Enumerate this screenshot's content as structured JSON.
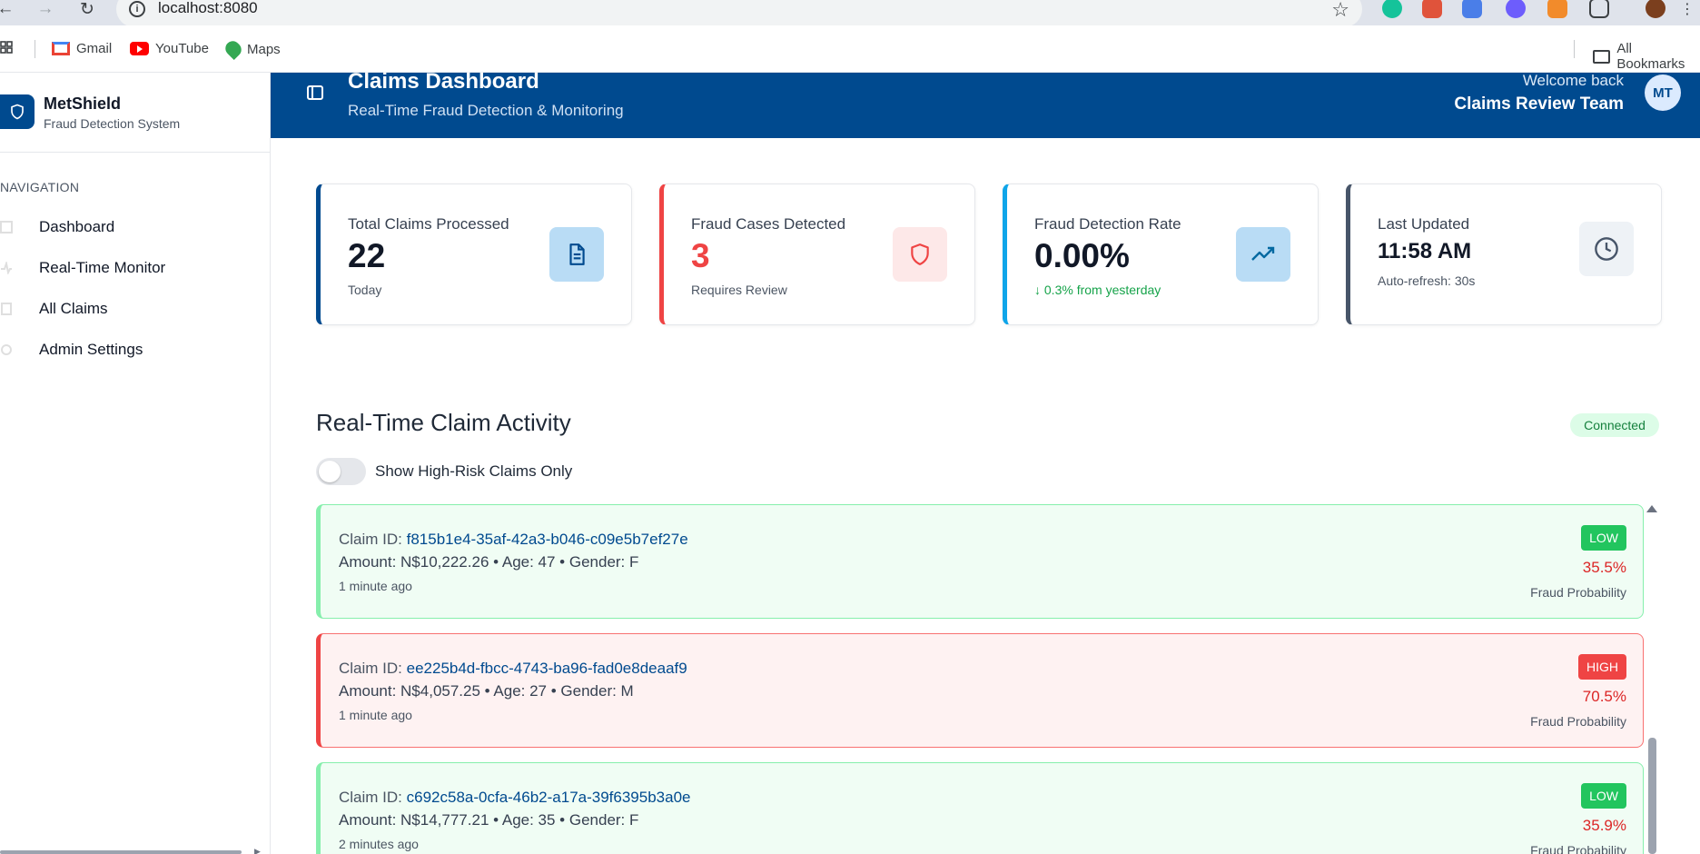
{
  "browser": {
    "url": "localhost:8080",
    "bookmarks": [
      {
        "label": "Gmail",
        "icon": "gmail-icon"
      },
      {
        "label": "YouTube",
        "icon": "youtube-icon"
      },
      {
        "label": "Maps",
        "icon": "maps-icon"
      }
    ],
    "all_bookmarks": "All Bookmarks"
  },
  "sidebar": {
    "app_name": "MetShield",
    "app_subtitle": "Fraud Detection System",
    "nav_heading": "NAVIGATION",
    "items": [
      {
        "label": "Dashboard",
        "icon": "dashboard-icon"
      },
      {
        "label": "Real-Time Monitor",
        "icon": "activity-icon"
      },
      {
        "label": "All Claims",
        "icon": "file-icon"
      },
      {
        "label": "Admin Settings",
        "icon": "settings-icon"
      }
    ]
  },
  "header": {
    "title": "Claims Dashboard",
    "subtitle": "Real-Time Fraud Detection & Monitoring",
    "welcome": "Welcome back",
    "team": "Claims Review Team",
    "avatar_initials": "MT"
  },
  "stats": [
    {
      "label": "Total Claims Processed",
      "value": "22",
      "sub": "Today",
      "icon": "document-icon",
      "accent": "#004a8f"
    },
    {
      "label": "Fraud Cases Detected",
      "value": "3",
      "sub": "Requires Review",
      "icon": "shield-icon",
      "accent": "#ef4444"
    },
    {
      "label": "Fraud Detection Rate",
      "value": "0.00%",
      "sub": "↓ 0.3% from yesterday",
      "icon": "trending-up-icon",
      "accent": "#0ea5e9"
    },
    {
      "label": "Last Updated",
      "value": "11:58 AM",
      "sub": "Auto-refresh: 30s",
      "icon": "clock-icon",
      "accent": "#475569"
    }
  ],
  "activity": {
    "title": "Real-Time Claim Activity",
    "status": "Connected",
    "toggle_label": "Show High-Risk Claims Only",
    "toggle_on": false,
    "id_prefix": "Claim ID: ",
    "probability_label": "Fraud Probability",
    "claims": [
      {
        "id": "f815b1e4-35af-42a3-b046-c09e5b7ef27e",
        "meta": "Amount: N$10,222.26 • Age: 47 • Gender: F",
        "time": "1 minute ago",
        "risk": "LOW",
        "probability": "35.5%"
      },
      {
        "id": "ee225b4d-fbcc-4743-ba96-fad0e8deaaf9",
        "meta": "Amount: N$4,057.25 • Age: 27 • Gender: M",
        "time": "1 minute ago",
        "risk": "HIGH",
        "probability": "70.5%"
      },
      {
        "id": "c692c58a-0cfa-46b2-a17a-39f6395b3a0e",
        "meta": "Amount: N$14,777.21 • Age: 35 • Gender: F",
        "time": "2 minutes ago",
        "risk": "LOW",
        "probability": "35.9%"
      }
    ]
  },
  "colors": {
    "brand": "#004a8f",
    "low": "#22c55e",
    "high": "#ef4444",
    "connected_bg": "#dcfce7"
  }
}
